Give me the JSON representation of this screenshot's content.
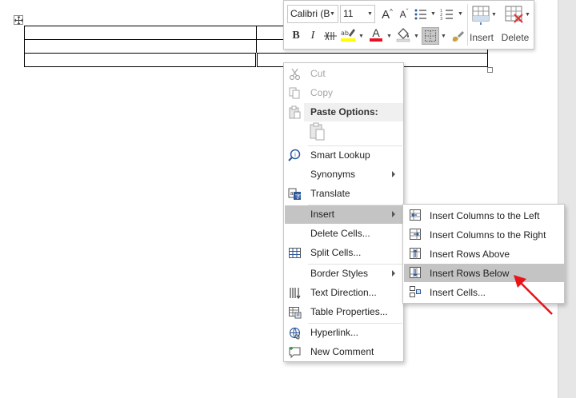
{
  "mini_toolbar": {
    "font_name": "Calibri (B",
    "font_size": "11",
    "insert_label": "Insert",
    "delete_label": "Delete",
    "bold": "B",
    "italic": "I",
    "font_color": "A",
    "grow_font": "A",
    "shrink_font": "A",
    "highlight_color": "#ffff00",
    "font_color_bar": "#e81123"
  },
  "context_menu": {
    "cut": "Cut",
    "copy": "Copy",
    "paste_options": "Paste Options:",
    "smart_lookup": "Smart Lookup",
    "synonyms": "Synonyms",
    "translate": "Translate",
    "insert": "Insert",
    "delete_cells": "Delete Cells...",
    "split_cells": "Split Cells...",
    "border_styles": "Border Styles",
    "text_direction": "Text Direction...",
    "table_properties": "Table Properties...",
    "hyperlink": "Hyperlink...",
    "new_comment": "New Comment"
  },
  "insert_submenu": {
    "columns_left": "Insert Columns to the Left",
    "columns_right": "Insert Columns to the Right",
    "rows_above": "Insert Rows Above",
    "rows_below": "Insert Rows Below",
    "cells": "Insert Cells..."
  },
  "colors": {
    "highlight": "#c4c4c4",
    "annotation_arrow": "#e8141a",
    "disabled_text": "#a6a6a6"
  }
}
